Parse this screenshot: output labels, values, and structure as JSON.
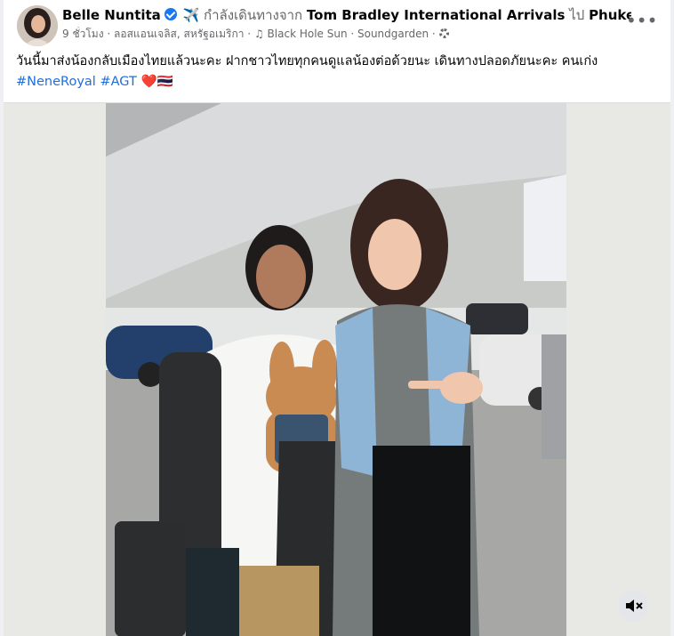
{
  "post": {
    "author": "Belle Nuntita",
    "activity_prefix": "✈️ กำลังเดินทางจาก",
    "from_place": "Tom Bradley International Arrivals",
    "to_word": "ไป",
    "to_place": "Phuket T...",
    "time": "9 ชั่วโมง",
    "location": "ลอสแอนเจลิส, สหรัฐอเมริกา",
    "music": "Black Hole Sun · Soundgarden",
    "caption": "วันนี้มาส่งน้องกลับเมืองไทยแล้วนะคะ ฝากชาวไทยทุกคนดูแลน้องต่อด้วยนะ เดินทางปลอดภัยนะคะ คนเก่ง",
    "hashtags": [
      "#NeneRoyal",
      "#AGT"
    ],
    "emoji": "❤️🇹🇭"
  },
  "icons": {
    "verified": "verified-badge-icon",
    "music": "music-note-icon",
    "privacy": "gear-icon",
    "more": "more-dots-icon",
    "mute": "speaker-muted-icon"
  },
  "colors": {
    "link": "#216fdb",
    "verified": "#1877f2",
    "secondary_text": "#65676b"
  }
}
